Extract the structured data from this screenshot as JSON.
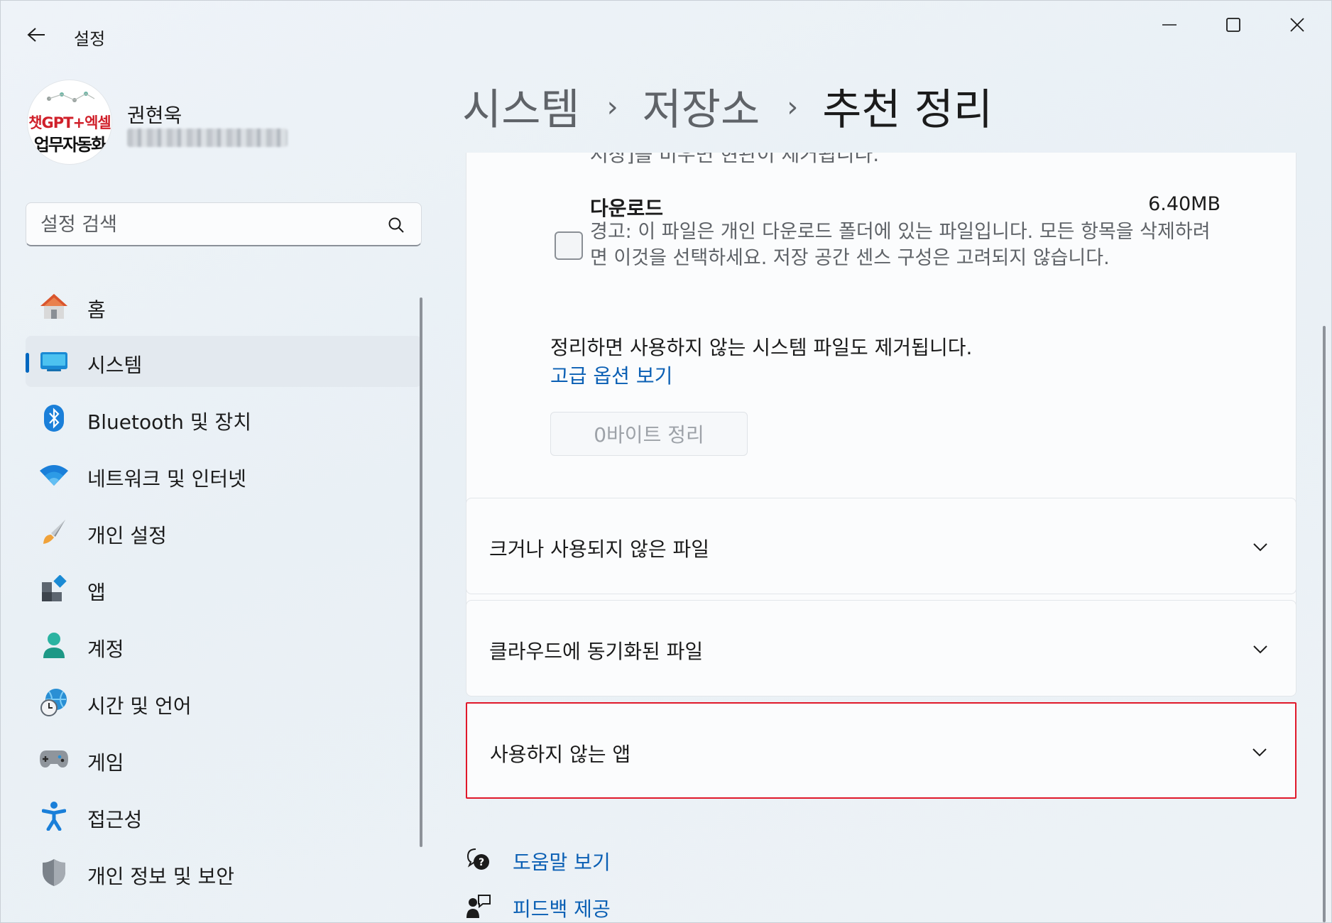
{
  "window": {
    "title": "설정",
    "controls": {
      "minimize": "minimize-icon",
      "maximize": "maximize-icon",
      "close": "close-icon"
    }
  },
  "profile": {
    "name": "권현욱",
    "avatar_text_line1": "챗GPT+엑셀",
    "avatar_text_line2": "업무자동화"
  },
  "search": {
    "placeholder": "설정 검색"
  },
  "sidebar": {
    "items": [
      {
        "label": "홈",
        "icon": "home-icon"
      },
      {
        "label": "시스템",
        "icon": "system-icon",
        "active": true
      },
      {
        "label": "Bluetooth 및 장치",
        "icon": "bluetooth-icon"
      },
      {
        "label": "네트워크 및 인터넷",
        "icon": "wifi-icon"
      },
      {
        "label": "개인 설정",
        "icon": "brush-icon"
      },
      {
        "label": "앱",
        "icon": "apps-icon"
      },
      {
        "label": "계정",
        "icon": "account-icon"
      },
      {
        "label": "시간 및 언어",
        "icon": "time-language-icon"
      },
      {
        "label": "게임",
        "icon": "gamepad-icon"
      },
      {
        "label": "접근성",
        "icon": "accessibility-icon"
      },
      {
        "label": "개인 정보 및 보안",
        "icon": "shield-icon"
      }
    ]
  },
  "breadcrumb": {
    "items": [
      "시스템",
      "저장소",
      "추천 정리"
    ],
    "separator": "›"
  },
  "cleanup": {
    "cut_text": "저장]를 비우면 현관이 제거됩니다.",
    "downloads": {
      "title": "다운로드",
      "size": "6.40MB",
      "description": "경고: 이 파일은 개인 다운로드 폴더에 있는 파일입니다. 모든 항목을 삭제하려면 이것을 선택하세요. 저장 공간 센스 구성은 고려되지 않습니다.",
      "checked": false
    },
    "note": "정리하면 사용하지 않는 시스템 파일도 제거됩니다.",
    "advanced_link": "고급 옵션 보기",
    "clean_button": "0바이트 정리"
  },
  "expanders": [
    {
      "label": "크거나 사용되지 않은 파일"
    },
    {
      "label": "클라우드에 동기화된 파일"
    },
    {
      "label": "사용하지 않는 앱",
      "highlighted": true
    }
  ],
  "help": {
    "get_help": "도움말 보기",
    "feedback": "피드백 제공"
  },
  "colors": {
    "accent": "#0067c0",
    "link": "#0a5fb4",
    "highlight_border": "#e0182a"
  }
}
